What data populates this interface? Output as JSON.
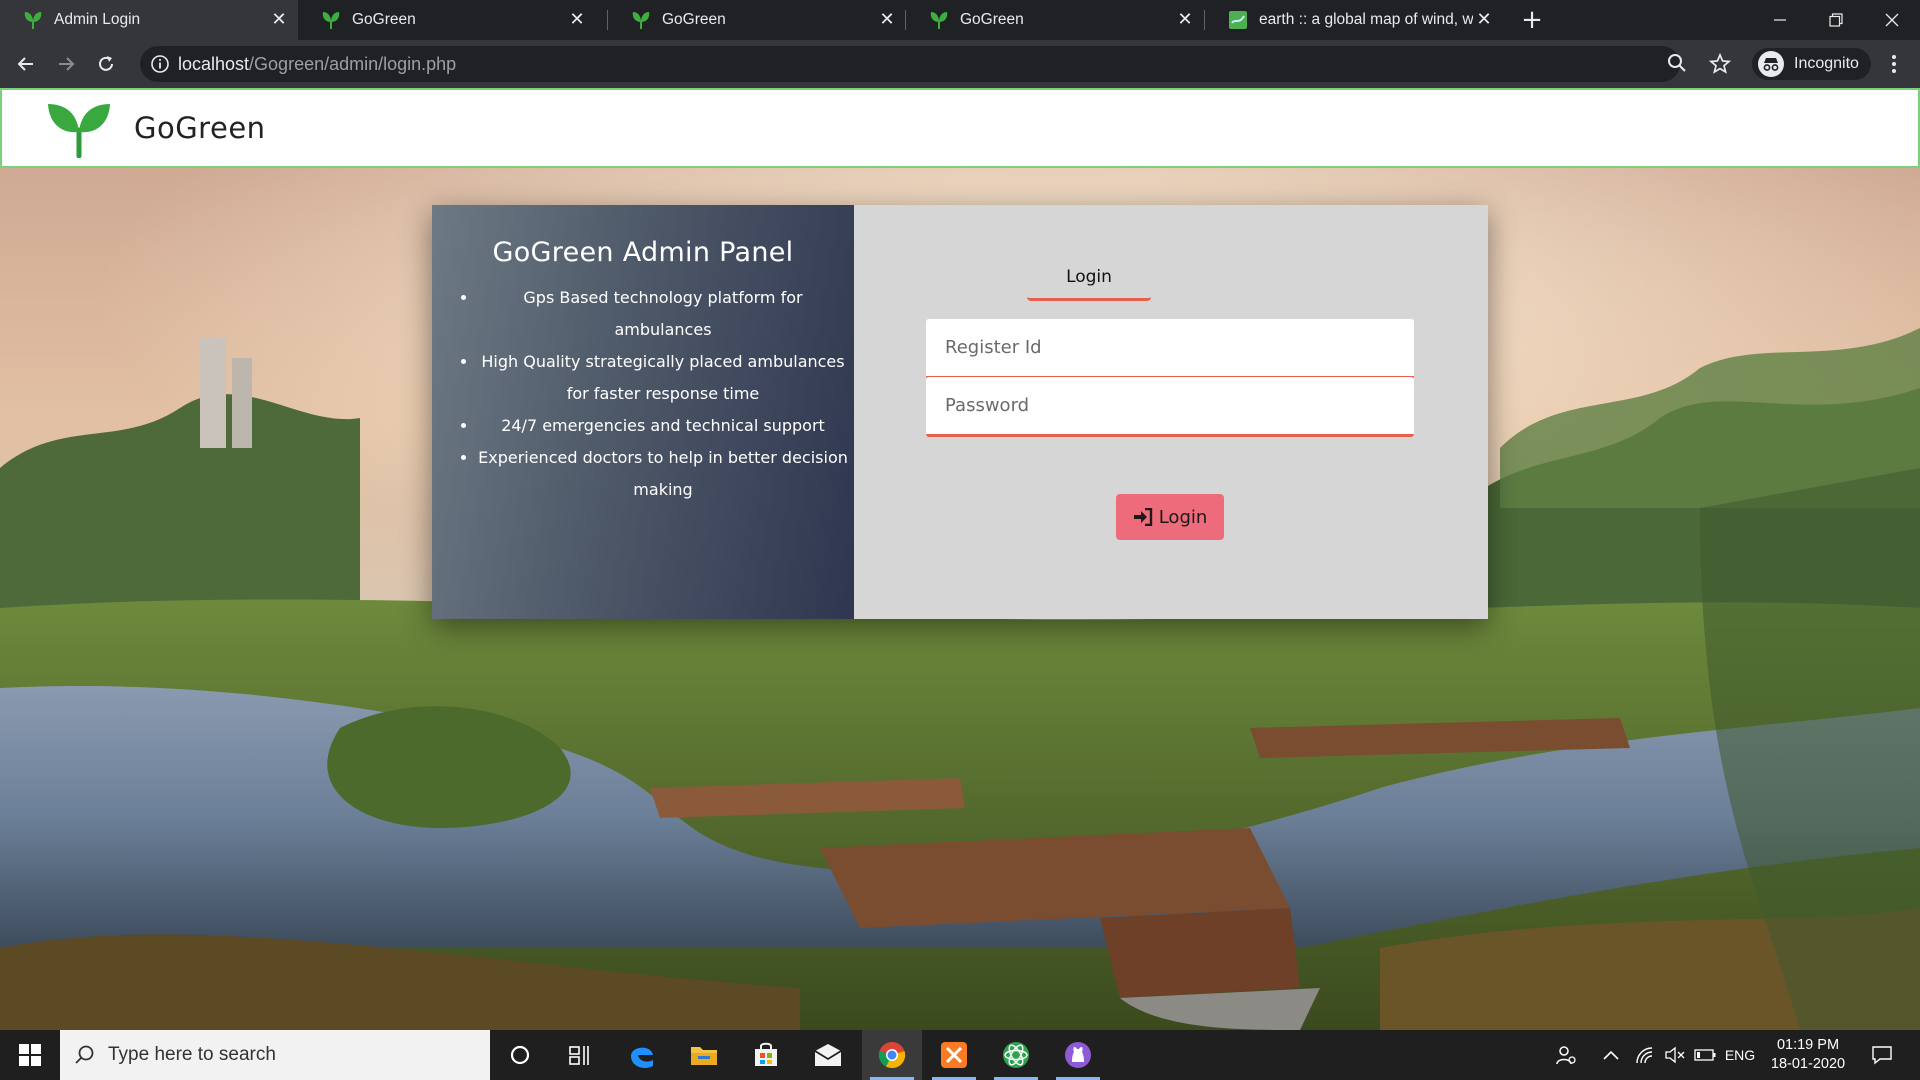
{
  "browser": {
    "tabs": [
      {
        "title": "Admin Login",
        "favicon": "gogreen-leaf-icon",
        "active": true
      },
      {
        "title": "GoGreen",
        "favicon": "gogreen-leaf-icon",
        "active": false
      },
      {
        "title": "GoGreen",
        "favicon": "gogreen-leaf-icon",
        "active": false
      },
      {
        "title": "GoGreen",
        "favicon": "gogreen-leaf-icon",
        "active": false
      },
      {
        "title": "earth :: a global map of wind, we",
        "favicon": "earth-map-icon",
        "active": false
      }
    ],
    "address": {
      "host": "localhost",
      "path": "/Gogreen/admin/login.php"
    },
    "profile_label": "Incognito"
  },
  "site": {
    "brand": "GoGreen",
    "panel": {
      "title": "GoGreen Admin Panel",
      "features": [
        "Gps Based technology platform for ambulances",
        "High Quality strategically placed ambulances for faster response time",
        "24/7 emergencies and technical support",
        "Experienced doctors to help in better decision making"
      ]
    },
    "form": {
      "tab_label": "Login",
      "register_placeholder": "Register Id",
      "password_placeholder": "Password",
      "submit_label": "Login"
    }
  },
  "taskbar": {
    "search_placeholder": "Type here to search",
    "pinned": [
      "cortana-icon",
      "task-view-icon",
      "edge-icon",
      "file-explorer-icon",
      "store-icon",
      "mail-icon",
      "chrome-icon",
      "xampp-icon",
      "atom-like-icon",
      "github-desktop-icon"
    ],
    "language": "ENG",
    "time": "01:19 PM",
    "date": "18-01-2020"
  },
  "colors": {
    "accent": "#e8604c",
    "button": "#ee6b7b",
    "header_border": "#7bd27b",
    "brand_green": "#3a9b3a"
  }
}
